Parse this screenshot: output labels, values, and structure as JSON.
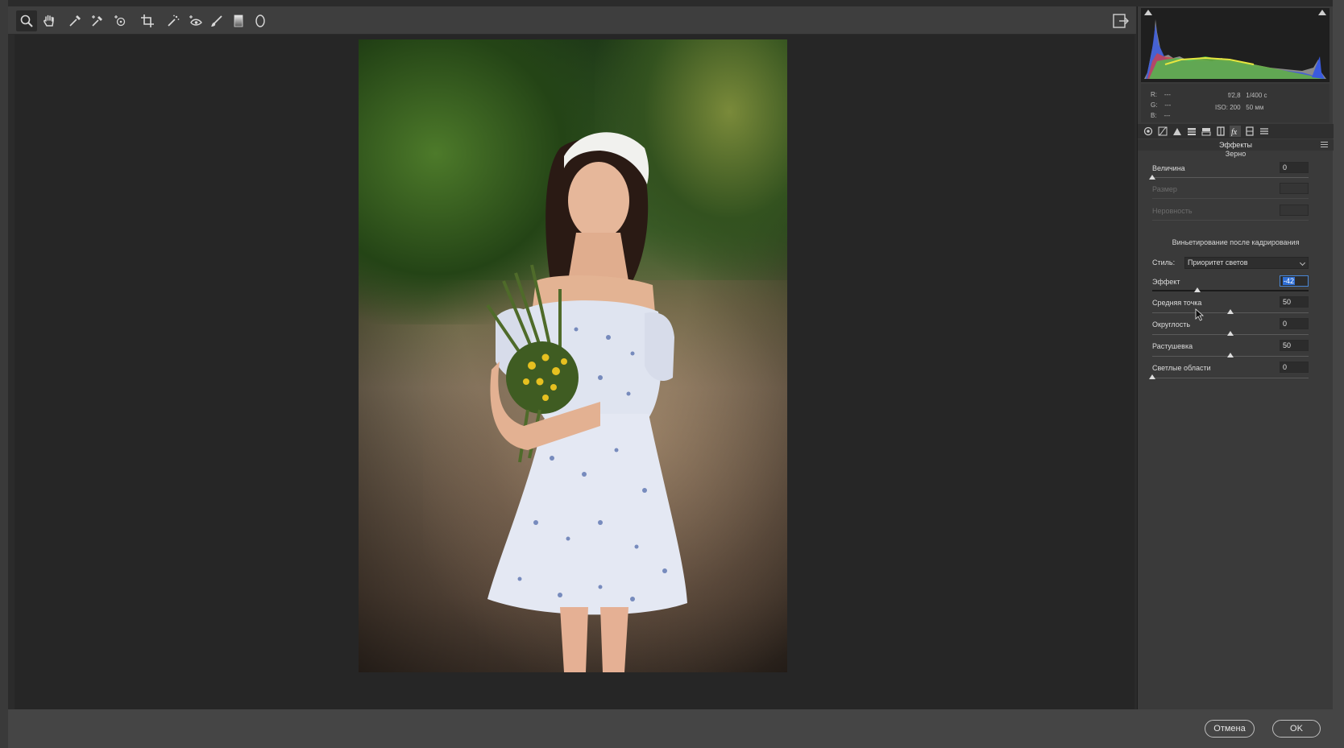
{
  "toolbar": {
    "tools": [
      {
        "name": "zoom-tool",
        "icon": "magnifier-icon",
        "active": true
      },
      {
        "name": "hand-tool",
        "icon": "hand-icon"
      },
      {
        "name": "white-balance-tool",
        "icon": "eyedropper-icon"
      },
      {
        "name": "color-sampler-tool",
        "icon": "eyedropper-plus-icon"
      },
      {
        "name": "targeted-adjustment-tool",
        "icon": "target-icon"
      },
      {
        "name": "crop-tool",
        "icon": "crop-icon"
      },
      {
        "name": "spot-removal-tool",
        "icon": "healing-icon"
      },
      {
        "name": "red-eye-tool",
        "icon": "eye-icon"
      },
      {
        "name": "adjustment-brush-tool",
        "icon": "brush-icon"
      },
      {
        "name": "graduated-filter-tool",
        "icon": "gradient-icon"
      },
      {
        "name": "radial-filter-tool",
        "icon": "ellipse-icon"
      }
    ],
    "export_icon": "export-icon"
  },
  "info": {
    "r_label": "R:",
    "g_label": "G:",
    "b_label": "B:",
    "r_value": "---",
    "g_value": "---",
    "b_value": "---",
    "aperture": "f/2,8",
    "shutter": "1/400 с",
    "iso": "ISO: 200",
    "focal": "50 мм"
  },
  "panel": {
    "section_title": "Эффекты",
    "grain": {
      "title": "Зерно",
      "amount_label": "Величина",
      "amount_value": "0",
      "amount_fraction": 0,
      "size_label": "Размер",
      "roughness_label": "Неровность"
    },
    "vignette": {
      "title": "Виньетирование после кадрирования",
      "style_label": "Стиль:",
      "style_value": "Приоритет светов",
      "amount_label": "Эффект",
      "amount_value": "-42",
      "amount_fraction": 0.29,
      "midpoint_label": "Средняя точка",
      "midpoint_value": "50",
      "midpoint_fraction": 0.5,
      "roundness_label": "Округлость",
      "roundness_value": "0",
      "roundness_fraction": 0.5,
      "feather_label": "Растушевка",
      "feather_value": "50",
      "feather_fraction": 0.5,
      "highlights_label": "Светлые области",
      "highlights_value": "0",
      "highlights_fraction": 0
    }
  },
  "footer": {
    "cancel_label": "Отмена",
    "ok_label": "OK"
  },
  "colors": {
    "selection": "#2f6fd6",
    "panel_bg": "#3a3a3a",
    "canvas_bg": "#262626"
  }
}
